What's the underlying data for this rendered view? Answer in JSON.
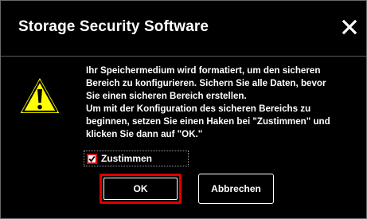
{
  "dialog": {
    "title": "Storage Security Software",
    "close_icon": "close-icon",
    "warning_icon": "warning-triangle-icon",
    "message_lines": [
      "Ihr Speichermedium wird formatiert, um den sicheren",
      "Bereich zu konfigurieren. Sichern Sie alle Daten, bevor",
      "Sie einen sicheren Bereich erstellen.",
      "Um mit der Konfiguration des sicheren Bereichs zu",
      "beginnen, setzen Sie einen Haken bei \"Zustimmen\" und",
      "klicken Sie dann auf \"OK.\""
    ],
    "agree": {
      "label": "Zustimmen",
      "checked": true
    },
    "buttons": {
      "ok_label": "OK",
      "cancel_label": "Abbrechen"
    }
  },
  "colors": {
    "background": "#000000",
    "text": "#ffffff",
    "highlight": "#e00000",
    "warning_fill": "#ffff00"
  }
}
